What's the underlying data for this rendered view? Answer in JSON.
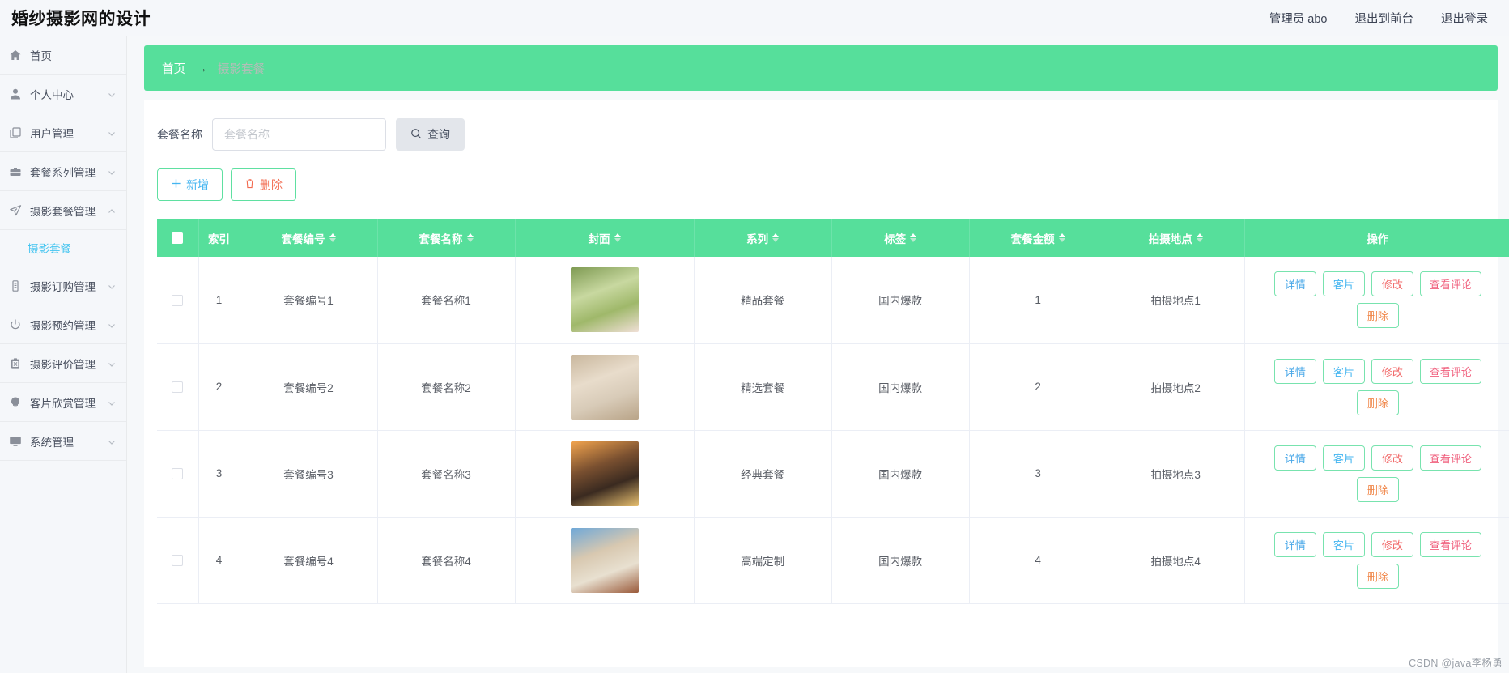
{
  "header": {
    "title": "婚纱摄影网的设计",
    "links": [
      {
        "name": "admin-name",
        "label": "管理员 abo"
      },
      {
        "name": "exit-to-front",
        "label": "退出到前台"
      },
      {
        "name": "logout",
        "label": "退出登录"
      }
    ]
  },
  "sidebar": {
    "items": [
      {
        "label": "首页",
        "icon": "home-icon",
        "expandable": false,
        "expanded": false
      },
      {
        "label": "个人中心",
        "icon": "user-icon",
        "expandable": true,
        "expanded": false
      },
      {
        "label": "用户管理",
        "icon": "copy-icon",
        "expandable": true,
        "expanded": false
      },
      {
        "label": "套餐系列管理",
        "icon": "briefcase-icon",
        "expandable": true,
        "expanded": false
      },
      {
        "label": "摄影套餐管理",
        "icon": "send-icon",
        "expandable": true,
        "expanded": true
      },
      {
        "label": "摄影订购管理",
        "icon": "mobile-icon",
        "expandable": true,
        "expanded": false
      },
      {
        "label": "摄影预约管理",
        "icon": "power-icon",
        "expandable": true,
        "expanded": false
      },
      {
        "label": "摄影评价管理",
        "icon": "clipboard-icon",
        "expandable": true,
        "expanded": false
      },
      {
        "label": "客片欣赏管理",
        "icon": "bulb-icon",
        "expandable": true,
        "expanded": false
      },
      {
        "label": "系统管理",
        "icon": "monitor-icon",
        "expandable": true,
        "expanded": false
      }
    ],
    "submenu": {
      "label": "摄影套餐",
      "parent_index": 4
    }
  },
  "breadcrumb": {
    "home": "首页",
    "separator": "→",
    "current": "摄影套餐"
  },
  "search": {
    "label": "套餐名称",
    "placeholder": "套餐名称",
    "value": "",
    "query_label": "查询",
    "query_icon": "search-icon"
  },
  "actions": [
    {
      "name": "add-button",
      "label": "新增",
      "icon": "plus-icon"
    },
    {
      "name": "delete-button",
      "label": "删除",
      "icon": "trash-icon"
    }
  ],
  "table": {
    "columns": [
      {
        "key": "check",
        "label": "",
        "sortable": false
      },
      {
        "key": "index",
        "label": "索引",
        "sortable": false
      },
      {
        "key": "code",
        "label": "套餐编号",
        "sortable": true
      },
      {
        "key": "name",
        "label": "套餐名称",
        "sortable": true
      },
      {
        "key": "cover",
        "label": "封面",
        "sortable": true
      },
      {
        "key": "series",
        "label": "系列",
        "sortable": true
      },
      {
        "key": "tag",
        "label": "标签",
        "sortable": true
      },
      {
        "key": "amount",
        "label": "套餐金额",
        "sortable": true
      },
      {
        "key": "place",
        "label": "拍摄地点",
        "sortable": true
      },
      {
        "key": "ops",
        "label": "操作",
        "sortable": false
      }
    ],
    "row_ops": [
      {
        "name": "detail-button",
        "label": "详情",
        "style": "op-detail"
      },
      {
        "name": "photo-button",
        "label": "客片",
        "style": "op-photo"
      },
      {
        "name": "edit-button",
        "label": "修改",
        "style": "op-edit"
      },
      {
        "name": "review-button",
        "label": "查看评论",
        "style": "op-review"
      },
      {
        "name": "delete-button",
        "label": "删除",
        "style": "op-delete"
      }
    ],
    "rows": [
      {
        "index": "1",
        "code": "套餐编号1",
        "name": "套餐名称1",
        "series": "精品套餐",
        "tag": "国内爆款",
        "amount": "1",
        "place": "拍摄地点1",
        "cover_alt": "新娘草地婚纱照",
        "cover_colors": [
          "#7e9a52",
          "#c8d8a0",
          "#f0dfd6",
          "#9fb86a"
        ]
      },
      {
        "index": "2",
        "code": "套餐编号2",
        "name": "套餐名称2",
        "series": "精选套餐",
        "tag": "国内爆款",
        "amount": "2",
        "place": "拍摄地点2",
        "cover_alt": "新娘室内婚纱照",
        "cover_colors": [
          "#c9b79d",
          "#e8dccb",
          "#b9a488",
          "#d8cbb8"
        ]
      },
      {
        "index": "3",
        "code": "套餐编号3",
        "name": "套餐名称3",
        "series": "经典套餐",
        "tag": "国内爆款",
        "amount": "3",
        "place": "拍摄地点3",
        "cover_alt": "海边日落婚纱照",
        "cover_colors": [
          "#f2a44e",
          "#7a5030",
          "#e8c070",
          "#3a2a20"
        ]
      },
      {
        "index": "4",
        "code": "套餐编号4",
        "name": "套餐名称4",
        "series": "高端定制",
        "tag": "国内爆款",
        "amount": "4",
        "place": "拍摄地点4",
        "cover_alt": "建筑前婚纱照",
        "cover_colors": [
          "#6fa8d8",
          "#d8c8b0",
          "#9a5a3a",
          "#e8e0d0"
        ]
      }
    ]
  },
  "watermark": "CSDN @java李杨勇"
}
